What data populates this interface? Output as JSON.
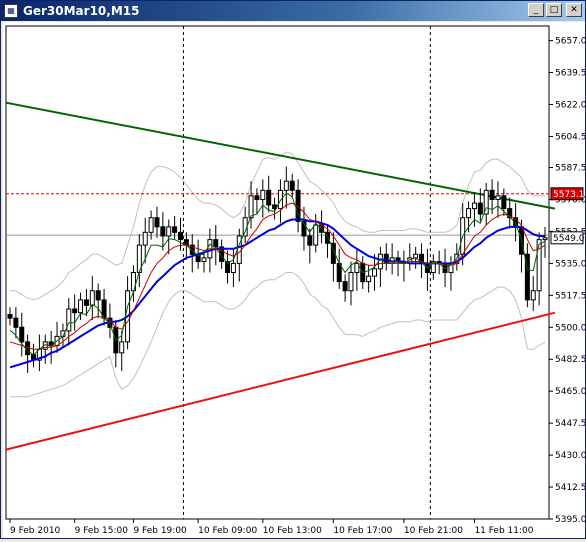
{
  "window": {
    "title": "Ger30Mar10,M15",
    "minimize_glyph": "_",
    "maximize_glyph": "□",
    "close_glyph": "✕",
    "app_icon": "chart-app-icon"
  },
  "chart_data": {
    "type": "candlestick",
    "symbol": "Ger30Mar10",
    "timeframe": "M15",
    "ylim": [
      5395,
      5665
    ],
    "y_ticks": [
      "5657.0",
      "5639.5",
      "5622.0",
      "5604.5",
      "5587.5",
      "5570.0",
      "5552.5",
      "5535.0",
      "5517.5",
      "5500.0",
      "5482.5",
      "5465.0",
      "5447.5",
      "5430.0",
      "5412.5",
      "5395.0"
    ],
    "x_ticks": [
      "9 Feb 2010",
      "9 Feb 15:00",
      "9 Feb 19:00",
      "10 Feb 09:00",
      "10 Feb 13:00",
      "10 Feb 17:00",
      "10 Feb 21:00",
      "11 Feb 11:00"
    ],
    "price_labels": [
      {
        "text": "5573.1",
        "value": 5573.1,
        "color": "#dd0000"
      },
      {
        "text": "5549.0",
        "value": 5549.0,
        "color": "#000000"
      }
    ],
    "horizontal_levels": [
      {
        "value": 5573.1,
        "color": "#dd0000",
        "style": "dotted"
      },
      {
        "value": 5550.5,
        "color": "#999999",
        "style": "solid"
      }
    ],
    "vertical_separators": [
      29.5,
      71.5
    ],
    "trendlines": [
      {
        "name": "",
        "color": "#006400",
        "x": [
          0,
          92
        ],
        "y": [
          5623,
          5565
        ]
      },
      {
        "name": "",
        "color": "#ee1111",
        "x": [
          0,
          92
        ],
        "y": [
          5433,
          5508
        ]
      }
    ],
    "closes": [
      5505,
      5500,
      5492,
      5485,
      5482,
      5488,
      5492,
      5490,
      5495,
      5498,
      5510,
      5508,
      5515,
      5512,
      5520,
      5515,
      5505,
      5500,
      5486,
      5492,
      5520,
      5530,
      5545,
      5552,
      5560,
      5555,
      5550,
      5555,
      5552,
      5548,
      5545,
      5540,
      5536,
      5538,
      5548,
      5544,
      5536,
      5530,
      5535,
      5550,
      5560,
      5572,
      5570,
      5575,
      5567,
      5565,
      5575,
      5580,
      5575,
      5558,
      5550,
      5545,
      5556,
      5552,
      5546,
      5535,
      5525,
      5520,
      5530,
      5535,
      5525,
      5528,
      5532,
      5540,
      5535,
      5538,
      5536,
      5535,
      5538,
      5540,
      5535,
      5530,
      5536,
      5535,
      5530,
      5535,
      5540,
      5560,
      5565,
      5568,
      5562,
      5575,
      5570,
      5572,
      5565,
      5560,
      5555,
      5540,
      5515,
      5520,
      5548,
      5549
    ],
    "ma_fast": [
      5492,
      5491,
      5490,
      5489,
      5488,
      5488,
      5489,
      5489,
      5490,
      5492,
      5495,
      5497,
      5500,
      5502,
      5505,
      5506,
      5505,
      5504,
      5500,
      5499,
      5503,
      5509,
      5516,
      5523,
      5530,
      5535,
      5538,
      5542,
      5544,
      5545,
      5545,
      5544,
      5543,
      5542,
      5543,
      5543,
      5542,
      5540,
      5539,
      5541,
      5545,
      5550,
      5554,
      5559,
      5561,
      5562,
      5564,
      5567,
      5568,
      5566,
      5563,
      5559,
      5558,
      5556,
      5554,
      5550,
      5545,
      5540,
      5538,
      5537,
      5535,
      5534,
      5534,
      5535,
      5535,
      5535,
      5535,
      5535,
      5536,
      5536,
      5536,
      5535,
      5535,
      5535,
      5534,
      5534,
      5535,
      5540,
      5545,
      5550,
      5552,
      5556,
      5559,
      5561,
      5562,
      5561,
      5559,
      5556,
      5548,
      5542,
      5543,
      5545
    ],
    "ma_slow": [
      5478,
      5479,
      5480,
      5481,
      5482,
      5483,
      5484,
      5486,
      5487,
      5489,
      5491,
      5493,
      5495,
      5497,
      5499,
      5501,
      5502,
      5503,
      5503,
      5504,
      5506,
      5509,
      5513,
      5517,
      5521,
      5525,
      5528,
      5531,
      5534,
      5536,
      5538,
      5539,
      5540,
      5541,
      5542,
      5543,
      5543,
      5543,
      5543,
      5544,
      5545,
      5547,
      5549,
      5551,
      5553,
      5554,
      5556,
      5558,
      5559,
      5559,
      5559,
      5558,
      5558,
      5557,
      5556,
      5554,
      5551,
      5548,
      5545,
      5543,
      5541,
      5539,
      5538,
      5537,
      5537,
      5536,
      5536,
      5536,
      5535,
      5535,
      5535,
      5535,
      5535,
      5535,
      5535,
      5535,
      5536,
      5538,
      5541,
      5544,
      5546,
      5549,
      5551,
      5553,
      5554,
      5555,
      5555,
      5555,
      5553,
      5551,
      5550,
      5550
    ],
    "envelope_upper": [
      5520,
      5520,
      5518,
      5516,
      5515,
      5516,
      5518,
      5520,
      5522,
      5525,
      5530,
      5532,
      5535,
      5537,
      5540,
      5540,
      5538,
      5536,
      5534,
      5535,
      5545,
      5555,
      5568,
      5578,
      5585,
      5588,
      5588,
      5587,
      5585,
      5582,
      5578,
      5574,
      5570,
      5568,
      5568,
      5567,
      5565,
      5562,
      5560,
      5562,
      5568,
      5578,
      5585,
      5592,
      5593,
      5592,
      5594,
      5596,
      5595,
      5590,
      5585,
      5580,
      5578,
      5575,
      5572,
      5568,
      5562,
      5558,
      5556,
      5555,
      5553,
      5552,
      5552,
      5553,
      5553,
      5553,
      5553,
      5553,
      5554,
      5554,
      5553,
      5552,
      5552,
      5552,
      5552,
      5553,
      5556,
      5568,
      5578,
      5585,
      5586,
      5590,
      5592,
      5592,
      5590,
      5588,
      5585,
      5582,
      5575,
      5572,
      5572,
      5572
    ],
    "envelope_lower": [
      5462,
      5462,
      5462,
      5462,
      5463,
      5464,
      5465,
      5466,
      5467,
      5468,
      5470,
      5472,
      5474,
      5476,
      5478,
      5480,
      5482,
      5484,
      5472,
      5466,
      5468,
      5472,
      5478,
      5485,
      5492,
      5500,
      5508,
      5514,
      5518,
      5520,
      5520,
      5518,
      5516,
      5514,
      5514,
      5514,
      5512,
      5510,
      5510,
      5512,
      5515,
      5520,
      5522,
      5525,
      5526,
      5526,
      5528,
      5530,
      5530,
      5528,
      5524,
      5518,
      5516,
      5512,
      5510,
      5505,
      5500,
      5496,
      5496,
      5496,
      5495,
      5497,
      5498,
      5500,
      5501,
      5502,
      5503,
      5503,
      5503,
      5504,
      5504,
      5503,
      5504,
      5504,
      5504,
      5504,
      5504,
      5508,
      5512,
      5515,
      5516,
      5518,
      5520,
      5522,
      5522,
      5520,
      5515,
      5505,
      5488,
      5488,
      5490,
      5492
    ]
  }
}
